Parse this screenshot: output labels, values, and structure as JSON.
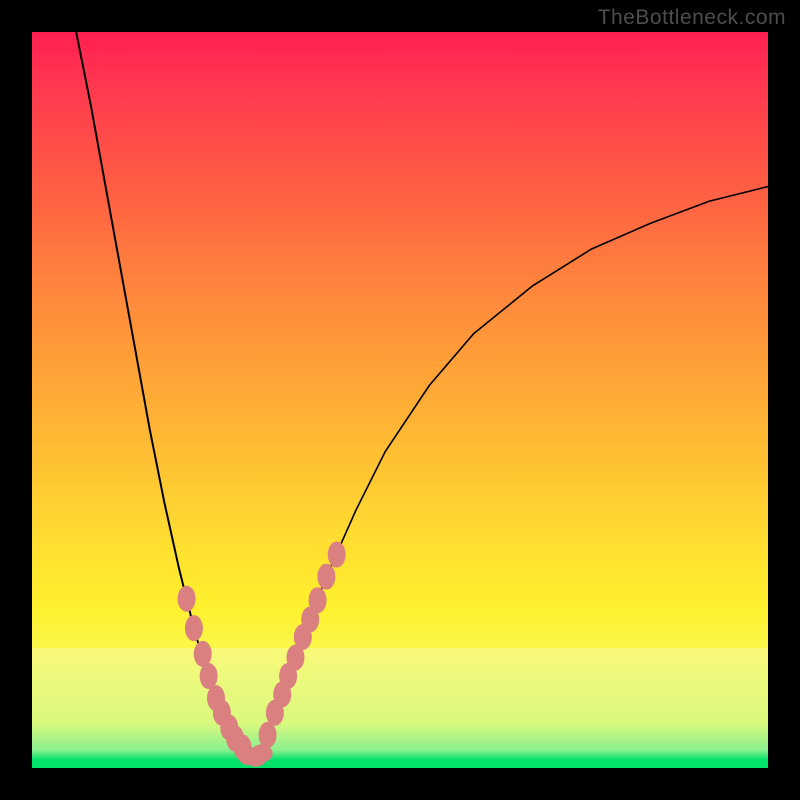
{
  "watermark": "TheBottleneck.com",
  "colors": {
    "frame": "#000000",
    "gradient_top": "#ff1f52",
    "gradient_mid": "#ffd633",
    "gradient_low": "#faf97a",
    "gradient_bottom": "#00e268",
    "curve": "#000000",
    "beads": "#db8080"
  },
  "chart_data": {
    "type": "line",
    "title": "",
    "xlabel": "",
    "ylabel": "",
    "xlim": [
      0,
      100
    ],
    "ylim": [
      0,
      100
    ],
    "note": "axes unlabeled in source image; x and y are normalized 0-100 within the colored plot area, y=0 at bottom",
    "series": [
      {
        "name": "left-curve",
        "x": [
          6,
          8,
          10,
          12,
          14,
          16,
          18,
          20,
          22,
          24,
          25,
          26,
          27,
          28,
          29,
          30
        ],
        "y": [
          100,
          90,
          79,
          68,
          57,
          46,
          36,
          27,
          19,
          12,
          9,
          6.5,
          4.5,
          3,
          2,
          1.2
        ]
      },
      {
        "name": "right-curve",
        "x": [
          30,
          31,
          32,
          34,
          36,
          38,
          40,
          44,
          48,
          54,
          60,
          68,
          76,
          84,
          92,
          100
        ],
        "y": [
          1.2,
          2.5,
          5,
          10,
          15.5,
          21,
          26,
          35,
          43,
          52,
          59,
          65.5,
          70.5,
          74,
          77,
          79
        ]
      },
      {
        "name": "beads-left",
        "x": [
          21.0,
          22.0,
          23.2,
          24.0,
          25.0,
          25.8,
          26.8,
          27.6,
          28.6
        ],
        "y": [
          23.0,
          19.0,
          15.5,
          12.5,
          9.5,
          7.5,
          5.5,
          4.0,
          2.8
        ]
      },
      {
        "name": "beads-bottom",
        "x": [
          29.5,
          30.4,
          31.2
        ],
        "y": [
          1.6,
          1.4,
          2.0
        ]
      },
      {
        "name": "beads-right",
        "x": [
          32.0,
          33.0,
          34.0,
          34.8,
          35.8,
          36.8,
          37.8,
          38.8,
          40.0,
          41.4
        ],
        "y": [
          4.5,
          7.5,
          10.0,
          12.5,
          15.0,
          17.8,
          20.2,
          22.8,
          26.0,
          29.0
        ]
      }
    ]
  }
}
